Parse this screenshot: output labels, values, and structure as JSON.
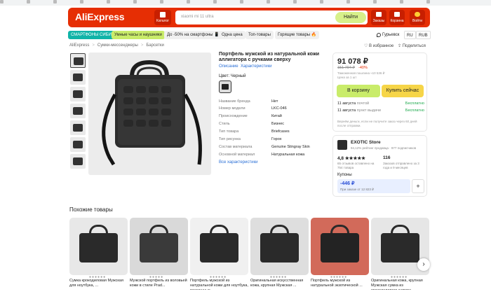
{
  "bookmarks": [
    "",
    "",
    "",
    "",
    "",
    "",
    "",
    "",
    "",
    "",
    "",
    "",
    "",
    "",
    "",
    "",
    ""
  ],
  "header": {
    "logo": "AliExpress",
    "catalog_label": "Каталог",
    "search_placeholder": "xiaomi mi 11 ultra",
    "search_button": "Найти",
    "orders_label": "Заказы",
    "cart_label": "Корзина",
    "login_label": "Войти"
  },
  "chips": [
    {
      "label": "СМАРТФОНЫ СИБИТ",
      "bg": "#10b4a8",
      "fg": "#ffffff"
    },
    {
      "label": "Умные часы и наушники",
      "bg": "#c9ec6a",
      "fg": "#222222"
    },
    {
      "label": "До -50% на смартфоны 📱",
      "bg": "#f0f0f0",
      "fg": "#222222"
    },
    {
      "label": "Одна цена",
      "bg": "#f0f0f0",
      "fg": "#222222"
    },
    {
      "label": "Топ-товары",
      "bg": "#f0f0f0",
      "fg": "#222222"
    },
    {
      "label": "Горящие товары 🔥",
      "bg": "#f0f0f0",
      "fg": "#222222"
    }
  ],
  "location": {
    "city": "Гурьевск",
    "lang": "RU",
    "currency": "RUB"
  },
  "breadcrumb": [
    "AliExpress",
    "Сумки-мессенджеры",
    "Барсетки"
  ],
  "top_actions": {
    "favorites": "В избранное",
    "share": "Поделиться"
  },
  "product": {
    "title": "Портфель мужской из натуральной кожи аллигатора с ручками сверху",
    "tabs": [
      "Описание",
      "Характеристики"
    ],
    "color_label": "Цвет: Черный",
    "specs": [
      {
        "k": "Название бренда",
        "v": "Нет"
      },
      {
        "k": "Номер модели",
        "v": "LKC-046"
      },
      {
        "k": "Происхождение",
        "v": "Китай"
      },
      {
        "k": "Стиль",
        "v": "Бизнес"
      },
      {
        "k": "Тип товара",
        "v": "Briefcases"
      },
      {
        "k": "Тип рисунка",
        "v": "Горох"
      },
      {
        "k": "Состав материала",
        "v": "Genuine Stingray Skin"
      },
      {
        "k": "Основной материал",
        "v": "Натуральная кожа"
      }
    ],
    "all_specs": "Все характеристики"
  },
  "price": {
    "current": "91 078 ₽",
    "old": "151 794 ₽",
    "discount": "-40%",
    "duty_note": "Таможенная пошлина ≈10 536 ₽",
    "per_unit": "Цена за 1 шт",
    "cart_button": "В корзину",
    "buy_button": "Купить сейчас",
    "delivery": [
      {
        "date": "11 августа",
        "method": "почтой",
        "cost": "Бесплатно"
      },
      {
        "date": "11 августа",
        "method": "пункт выдачи",
        "cost": "Бесплатно"
      }
    ],
    "refund_note": "Вернём деньги, если не получите заказ через 60 дней после отправки."
  },
  "store": {
    "name": "EXOTIC Store",
    "meta": "94,12% рейтинг продавца · 977 подписчиков",
    "rating": "4,8 ★★★★★",
    "rating_note": "65 отзывов оставлено на 754 товара",
    "orders": "116",
    "orders_note": "Заказов отправлено за 3 года и 9 месяцев"
  },
  "coupons": {
    "label": "Купоны",
    "amount": "-446 ₽",
    "condition": "При заказе от 12 823 ₽",
    "add": "+"
  },
  "similar": {
    "heading": "Похожие товары",
    "items": [
      {
        "title": "Сумка крокодиловая Мужская для ноутбука, ...",
        "bg": "#e8e8e8"
      },
      {
        "title": "Мужской портфель из воловьей кожи в стиле Prad...",
        "bg": "#d9d9d9"
      },
      {
        "title": "Портфель мужской из натуральной кожи для ноутбука, роскошные ...",
        "bg": "#f0f0f0"
      },
      {
        "title": "Оригинальная искусственная кожа, крупная Мужская ...",
        "bg": "#dedede"
      },
      {
        "title": "Портфель мужской из натуральной экзотической ...",
        "bg": "#d26a5a"
      },
      {
        "title": "Оригинальная кожа, крупная Мужская сумка из крокодилового живота ...",
        "bg": "#e6e6e6"
      }
    ]
  },
  "accent": "#e62e04"
}
